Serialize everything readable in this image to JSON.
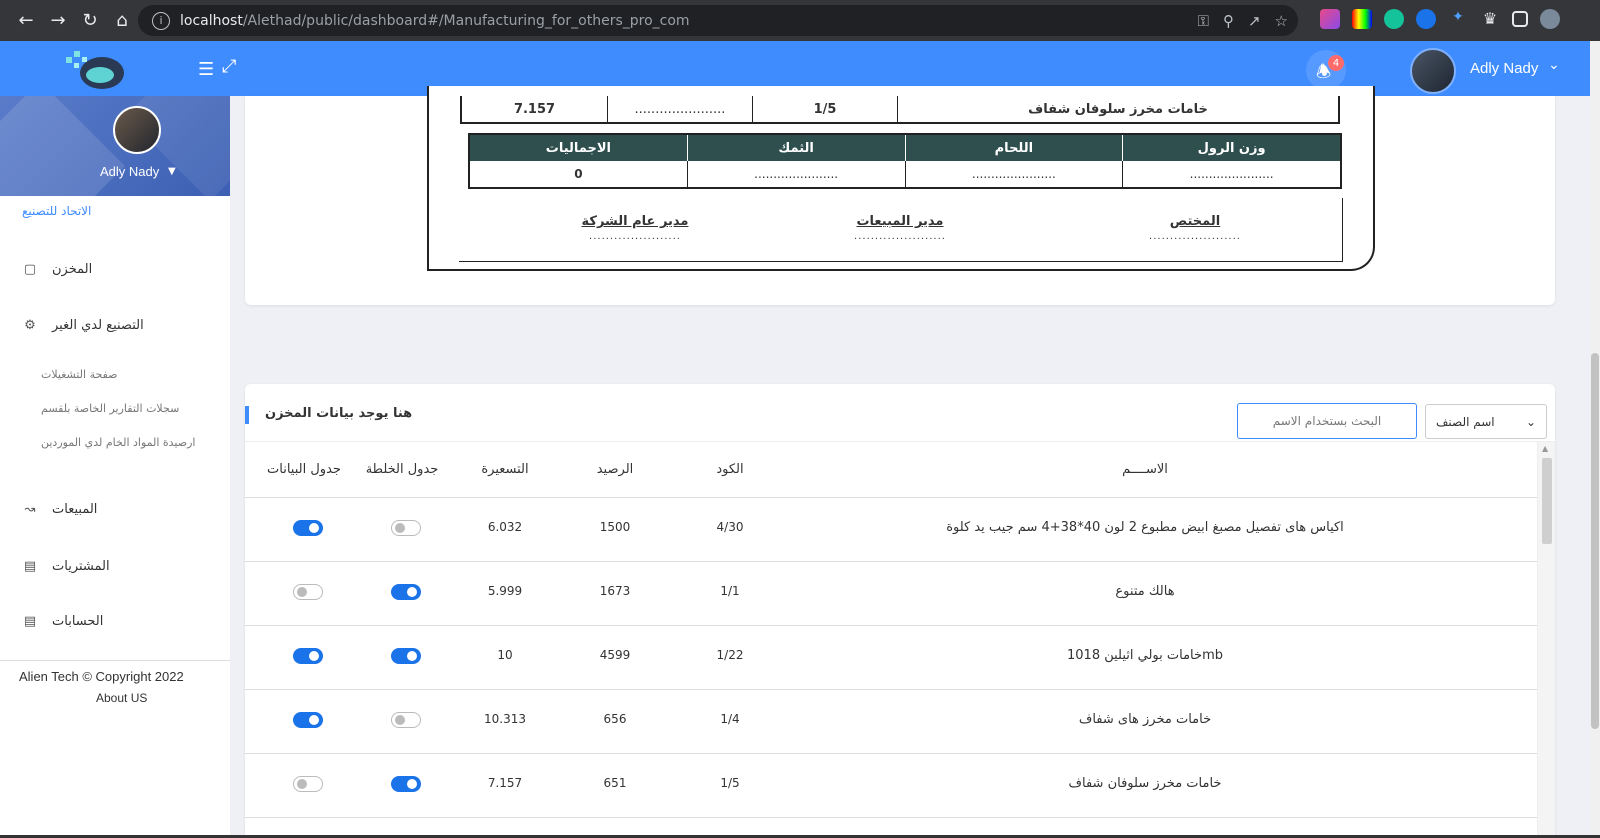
{
  "browser": {
    "url_host": "localhost",
    "url_path": "/Alethad/public/dashboard#/Manufacturing_for_others_pro_com"
  },
  "header": {
    "notification_count": "4",
    "user_name": "Adly Nady"
  },
  "sidebar": {
    "user_name": "Adly Nady",
    "brand": "الاتحاد للتصنيع",
    "items": [
      {
        "label": "المخزن",
        "icon": "box-icon"
      },
      {
        "label": "التصنيع لدي الغير",
        "icon": "gear-icon"
      },
      {
        "label": "المبيعات",
        "icon": "chart-line-icon"
      },
      {
        "label": "المشتريات",
        "icon": "card-icon"
      },
      {
        "label": "الحسابات",
        "icon": "card-icon"
      }
    ],
    "sub_items": [
      "صفحة التشغيلات",
      "سجلات التقارير الخاصة بلقسم",
      "ارصيدة المواد الخام لدي الموردين"
    ],
    "copyright": "Alien Tech © Copyright 2022",
    "about": "About US"
  },
  "report": {
    "row": {
      "total": "7.157",
      "dots": "......................",
      "code": "1/5",
      "name": "خامات مخرز سلوفان شفاف"
    },
    "headers": [
      "الاجماليات",
      "الثمك",
      "اللحام",
      "وزن الرول"
    ],
    "values": [
      "0",
      "......................",
      "......................",
      "......................"
    ],
    "signatures": [
      {
        "title": "مدير عام الشركة",
        "dots": "......................"
      },
      {
        "title": "مدير المبيعات",
        "dots": "......................"
      },
      {
        "title": "المختص",
        "dots": "......................"
      }
    ]
  },
  "inventory": {
    "title": "هنا يوجد بيانات المخزن",
    "search_placeholder": "البحث بستخدام الاسم",
    "select_value": "اسم الصنف",
    "columns": {
      "data_table": "جدول البيانات",
      "mix_table": "جدول الخلطة",
      "price": "التسعيرة",
      "balance": "الرصيد",
      "code": "الكود",
      "name": "الاســــم"
    },
    "rows": [
      {
        "name": "اكياس هاى تفصيل مصبغ ابيض مطبوع 2 لون 40*38+4 سم جيب يد كلوة",
        "code": "4/30",
        "balance": "1500",
        "price": "6.032",
        "mix": false,
        "data": true
      },
      {
        "name": "هالك متنوع",
        "code": "1/1",
        "balance": "1673",
        "price": "5.999",
        "mix": true,
        "data": false
      },
      {
        "name": "خامات بولي اثيلين 1018mb",
        "code": "1/22",
        "balance": "4599",
        "price": "10",
        "mix": true,
        "data": true
      },
      {
        "name": "خامات مخرز هاى شفاف",
        "code": "1/4",
        "balance": "656",
        "price": "10.313",
        "mix": false,
        "data": true
      },
      {
        "name": "خامات مخرز سلوفان شفاف",
        "code": "1/5",
        "balance": "651",
        "price": "7.157",
        "mix": true,
        "data": false
      }
    ]
  }
}
